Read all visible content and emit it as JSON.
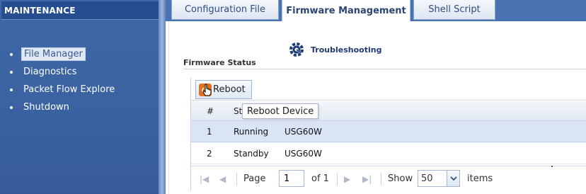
{
  "sidebar": {
    "header": "MAINTENANCE",
    "items": [
      {
        "label": "File Manager",
        "active": true
      },
      {
        "label": "Diagnostics"
      },
      {
        "label": "Packet Flow Explore"
      },
      {
        "label": "Shutdown"
      }
    ]
  },
  "tabs": [
    {
      "label": "Configuration File"
    },
    {
      "label": "Firmware Management",
      "active": true
    },
    {
      "label": "Shell Script"
    }
  ],
  "troubleshooting": {
    "label": "Troubleshooting",
    "icon": "gear-wrench-icon"
  },
  "section": {
    "title": "Firmware Status"
  },
  "toolbar": {
    "reboot_label": "Reboot",
    "reboot_icon": "power-icon",
    "tooltip": "Reboot Device"
  },
  "table": {
    "columns": [
      "#",
      "St"
    ],
    "rows": [
      {
        "num": "1",
        "status": "Running",
        "model": "USG60W"
      },
      {
        "num": "2",
        "status": "Standby",
        "model": "USG60W"
      }
    ]
  },
  "pager": {
    "page_label": "Page",
    "page_value": "1",
    "of_label": "of 1",
    "show_label": "Show",
    "page_size": "50",
    "items_label": "items"
  },
  "colors": {
    "sidebar": "#3b62a0",
    "accent": "#e2701c",
    "selected_row": "#d9e4f4"
  }
}
